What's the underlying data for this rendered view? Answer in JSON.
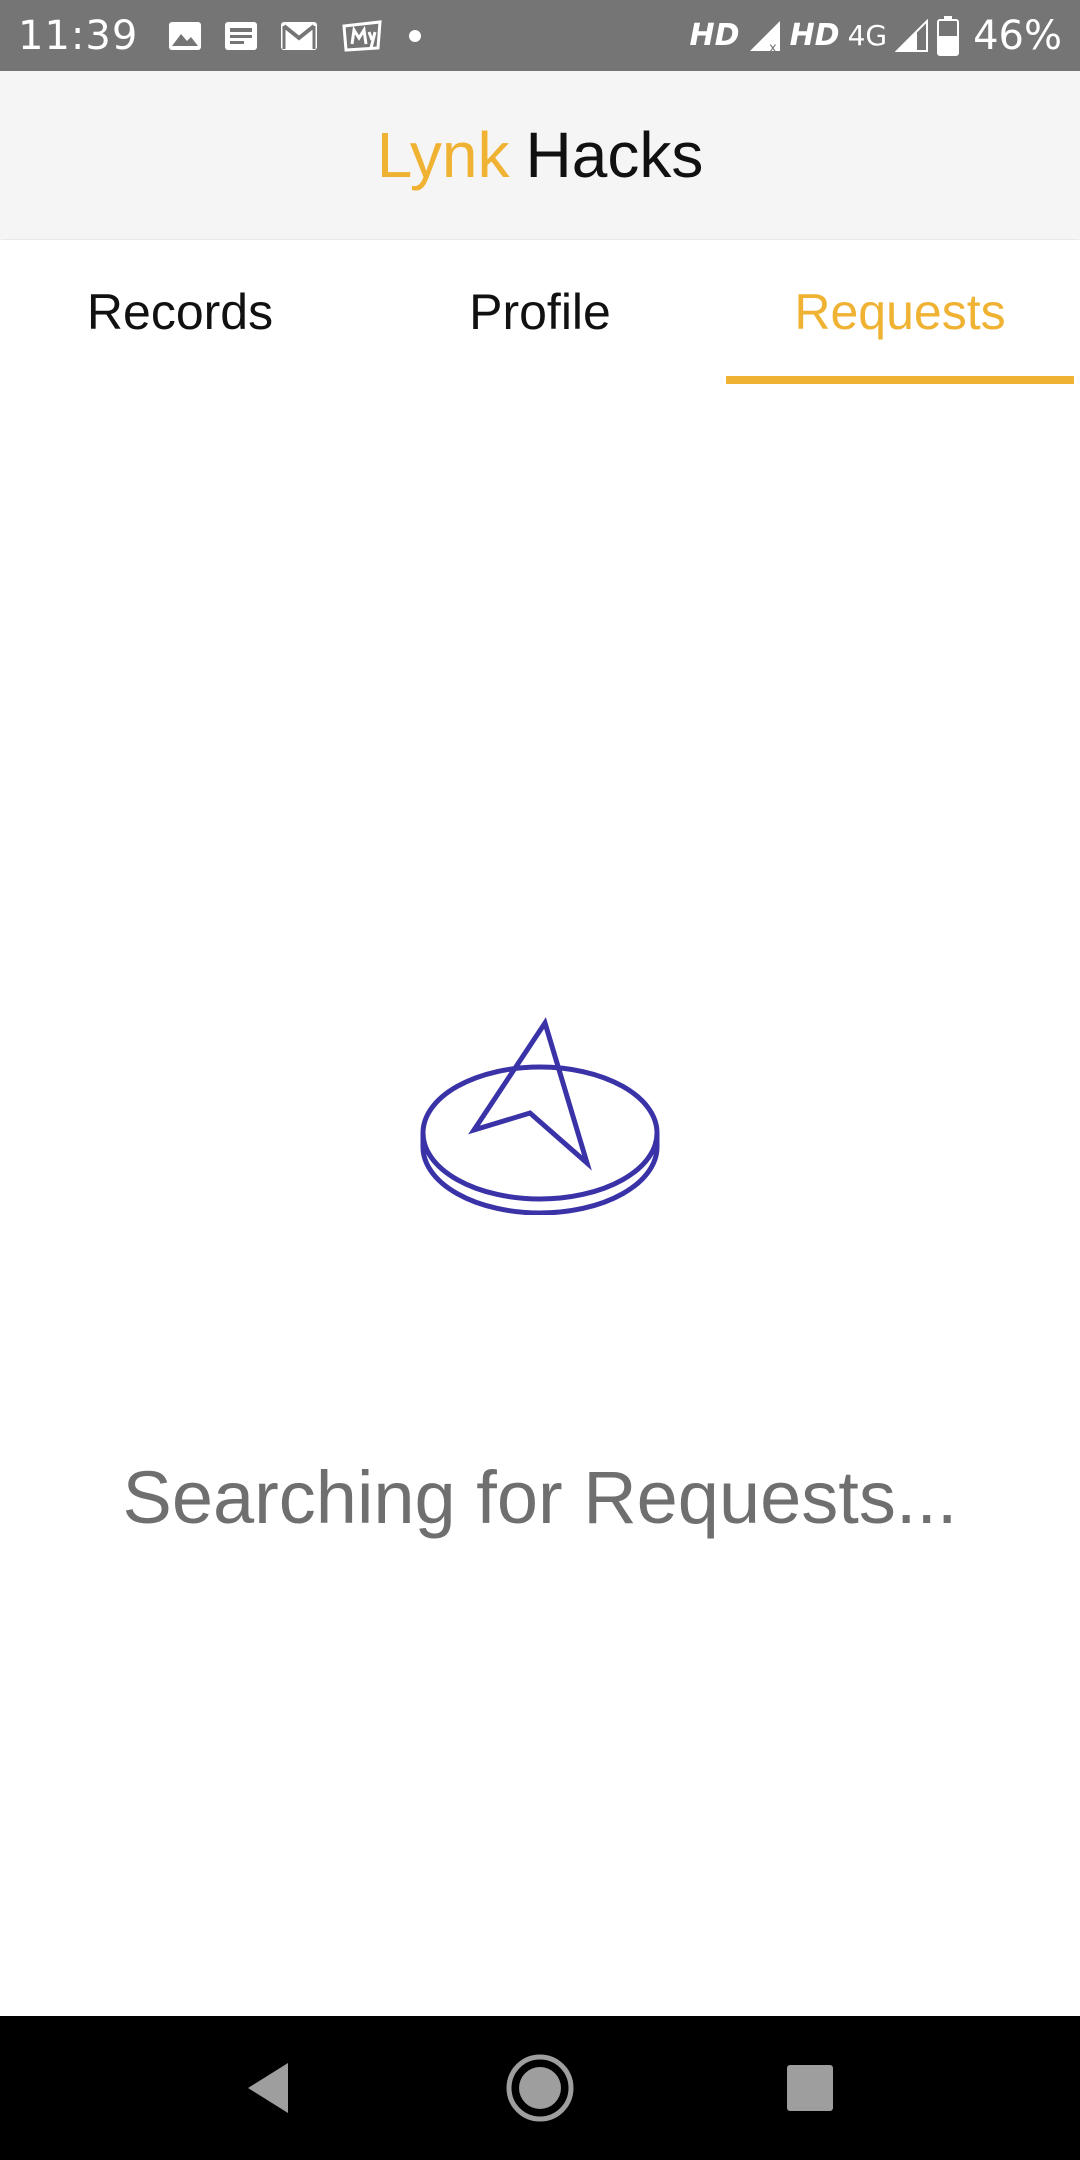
{
  "status_bar": {
    "time": "11:39",
    "icons_left": [
      "image-icon",
      "news-icon",
      "gmail-icon",
      "myntra-icon",
      "dot-icon"
    ],
    "hd1": "HD",
    "hd2": "HD",
    "network": "4G",
    "battery_percent": "46%"
  },
  "app_bar": {
    "title_accent": "Lynk",
    "title_main": "Hacks"
  },
  "tabs": [
    {
      "label": "Records",
      "active": false
    },
    {
      "label": "Profile",
      "active": false
    },
    {
      "label": "Requests",
      "active": true
    }
  ],
  "main": {
    "status_text": "Searching for Requests...",
    "icon": "compass-icon"
  },
  "nav_bar": {
    "back_icon": "back-icon",
    "home_icon": "home-icon",
    "recents_icon": "recents-icon"
  },
  "colors": {
    "accent": "#f0b232",
    "icon_blue": "#3a33a8",
    "status_bar_bg": "#757575",
    "app_bar_bg": "#f5f5f5",
    "status_text": "#6f6f6f"
  }
}
